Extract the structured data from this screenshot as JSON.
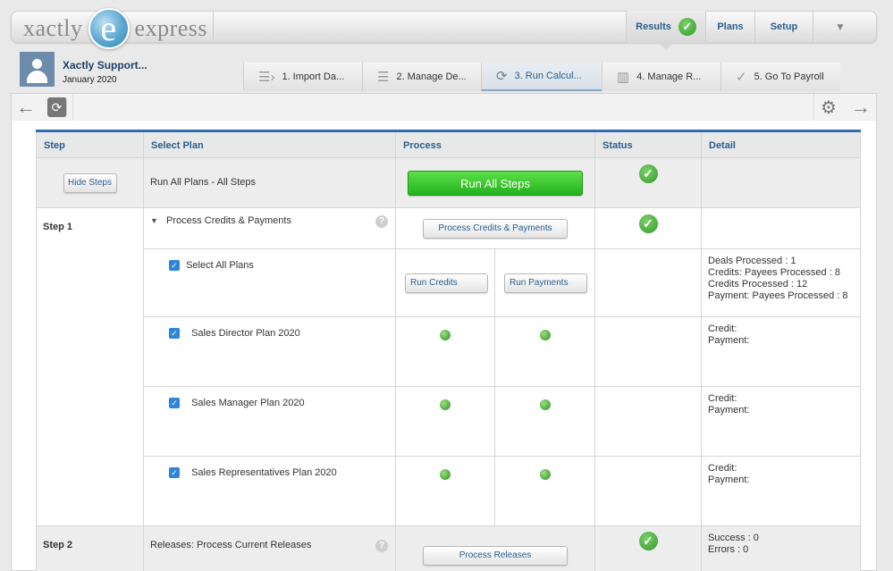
{
  "brand": {
    "left_word": "xactly",
    "mark": "e",
    "right_word": "express"
  },
  "nav": {
    "results": "Results",
    "plans": "Plans",
    "setup": "Setup",
    "more_icon": "chevron-down-icon"
  },
  "user": {
    "name": "Xactly Support...",
    "period": "January 2020"
  },
  "steps": [
    {
      "label": "1. Import Da...",
      "icon": "list-arrow-icon"
    },
    {
      "label": "2. Manage De...",
      "icon": "list-icon"
    },
    {
      "label": "3. Run Calcul...",
      "icon": "refresh-icon"
    },
    {
      "label": "4. Manage R...",
      "icon": "bar-chart-icon"
    },
    {
      "label": "5. Go To Payroll",
      "icon": "checkmark-icon"
    }
  ],
  "table": {
    "headers": [
      "Step",
      "Select Plan",
      "Process",
      "Status",
      "Detail"
    ],
    "hide_steps": "Hide Steps",
    "run_all_label": "Run All Plans - All Steps",
    "run_all_button": "Run All Steps",
    "step1": {
      "label": "Step 1",
      "title": "Process Credits & Payments",
      "button": "Process Credits & Payments",
      "select_all": "Select All Plans",
      "run_credits": "Run Credits",
      "run_payments": "Run Payments",
      "details": [
        "Deals Processed :  1",
        "Credits: Payees Processed :  8",
        "Credits Processed :  12",
        "Payment: Payees Processed :  8"
      ],
      "plans": [
        {
          "name": "Sales Director Plan 2020",
          "credit": "Credit:",
          "payment": "Payment:"
        },
        {
          "name": "Sales Manager Plan 2020",
          "credit": "Credit:",
          "payment": "Payment:"
        },
        {
          "name": "Sales Representatives Plan 2020",
          "credit": "Credit:",
          "payment": "Payment:"
        }
      ]
    },
    "step2": {
      "label": "Step 2",
      "title": "Releases: Process Current Releases",
      "button": "Process Releases",
      "details": [
        "Success :  0",
        "Errors :  0"
      ]
    }
  },
  "colors": {
    "accent": "#2f6db1",
    "link": "#2b5f8d",
    "success": "#2f9a2a"
  }
}
